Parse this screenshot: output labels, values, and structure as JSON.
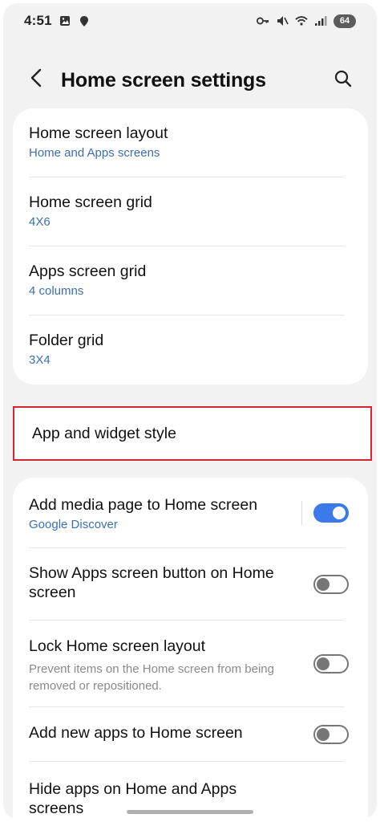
{
  "status_bar": {
    "time": "4:51",
    "battery": "64",
    "icons": [
      "gallery-icon",
      "location-icon",
      "key-icon",
      "mute-icon",
      "wifi-icon",
      "signal-icon"
    ]
  },
  "header": {
    "title": "Home screen settings",
    "back_icon": "back-arrow-icon",
    "search_icon": "search-icon"
  },
  "grid_settings": [
    {
      "title": "Home screen layout",
      "value": "Home and Apps screens"
    },
    {
      "title": "Home screen grid",
      "value": "4X6"
    },
    {
      "title": "Apps screen grid",
      "value": "4 columns"
    },
    {
      "title": "Folder grid",
      "value": "3X4"
    }
  ],
  "style_item": {
    "title": "App and widget style",
    "highlight_color": "#d7262d"
  },
  "toggles": [
    {
      "title": "Add media page to Home screen",
      "sub": "Google Discover",
      "on": true
    },
    {
      "title": "Show Apps screen button on Home screen",
      "on": false
    },
    {
      "title": "Lock Home screen layout",
      "desc": "Prevent items on the Home screen from being removed or repositioned.",
      "on": false
    },
    {
      "title": "Add new apps to Home screen",
      "on": false
    },
    {
      "title": "Hide apps on Home and Apps screens"
    }
  ],
  "colors": {
    "accent": "#3b7ae8",
    "link": "#3b6fb5",
    "background": "#f2f2f2"
  }
}
